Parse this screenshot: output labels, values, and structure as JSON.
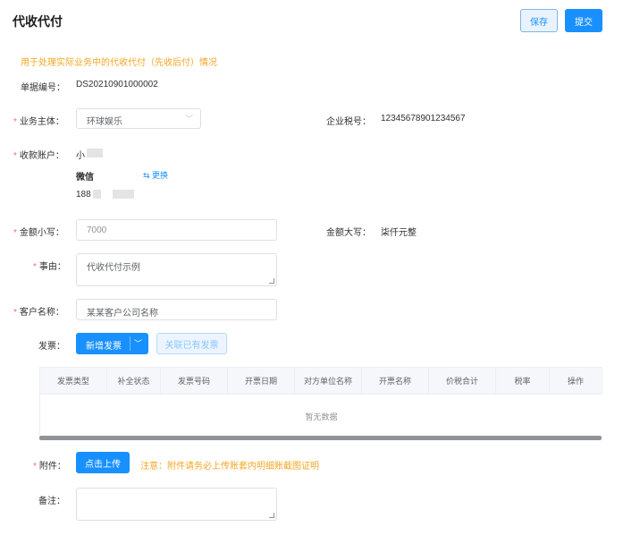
{
  "header": {
    "title": "代收代付",
    "save_label": "保存",
    "submit_label": "提交"
  },
  "hint": "用于处理实际业务中的代收代付（先收后付）情况",
  "doc_no": {
    "label": "单据编号：",
    "value": "DS20210901000002"
  },
  "entity": {
    "label": "业务主体：",
    "value": "环球娱乐",
    "icon": "chevron-down-icon"
  },
  "tax_no": {
    "label": "企业税号：",
    "value": "12345678901234567"
  },
  "account": {
    "label": "收款账户：",
    "name": "小",
    "channel": "微信",
    "change_label": "⇆ 更换",
    "phone": "188"
  },
  "amount": {
    "label": "金额小写：",
    "placeholder": "7000"
  },
  "amount_upper": {
    "label": "金额大写：",
    "value": "柒仟元整"
  },
  "reason": {
    "label": "事由：",
    "value": "代收代付示例"
  },
  "customer": {
    "label": "客户名称：",
    "value": "某某客户公司名称"
  },
  "invoice": {
    "label": "发票：",
    "new_label": "新增发票",
    "link_label": "关联已有发票",
    "columns": [
      "发票类型",
      "补全状态",
      "发票号码",
      "开票日期",
      "对方单位名称",
      "开票名称",
      "价税合计",
      "税率",
      "操作"
    ],
    "empty_text": "暂无数据"
  },
  "attachment": {
    "label": "附件：",
    "upload_label": "点击上传",
    "note": "注意：附件请务必上传账套内明细账截图证明"
  },
  "remark": {
    "label": "备注："
  },
  "colors": {
    "primary": "#1890ff",
    "warning": "#f5a623",
    "required": "#f56c6c"
  }
}
